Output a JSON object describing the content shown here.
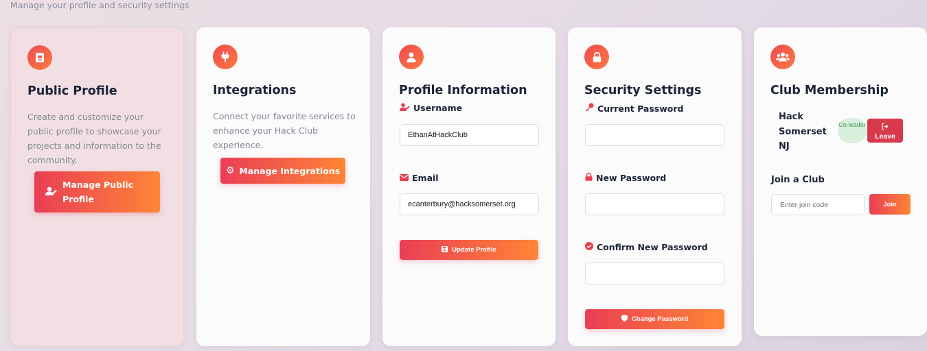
{
  "header": {
    "subtitle": "Manage your profile and security settings"
  },
  "colors": {
    "accent_start": "#ea3e55",
    "accent_end": "#ff8536",
    "badge_bg": "#d8efdc",
    "leave_bg": "#d63a4b"
  },
  "public_profile": {
    "icon": "id-badge-icon",
    "title": "Public Profile",
    "description": "Create and customize your public profile to showcase your projects and information to the community.",
    "button_line1": "Manage Public",
    "button_line2": "Profile"
  },
  "integrations": {
    "icon": "plug-icon",
    "title": "Integrations",
    "description": "Connect your favorite services to enhance your Hack Club experience.",
    "button_label": "Manage Integrations"
  },
  "profile_info": {
    "icon": "user-icon",
    "title": "Profile Information",
    "username_label": "Username",
    "username_value": "EthanAtHackClub",
    "email_label": "Email",
    "email_value": "ecanterbury@hacksomerset.org",
    "update_button": "Update Profile"
  },
  "security": {
    "icon": "lock-icon",
    "title": "Security Settings",
    "current_password_label": "Current Password",
    "new_password_label": "New Password",
    "confirm_password_label": "Confirm New Password",
    "change_button": "Change Password"
  },
  "club": {
    "icon": "users-icon",
    "title": "Club Membership",
    "club_name": "Hack Somerset NJ",
    "role_badge": "Co-leader",
    "leave_button": "Leave",
    "join_title": "Join a Club",
    "join_placeholder": "Enter join code",
    "join_button": "Join"
  }
}
